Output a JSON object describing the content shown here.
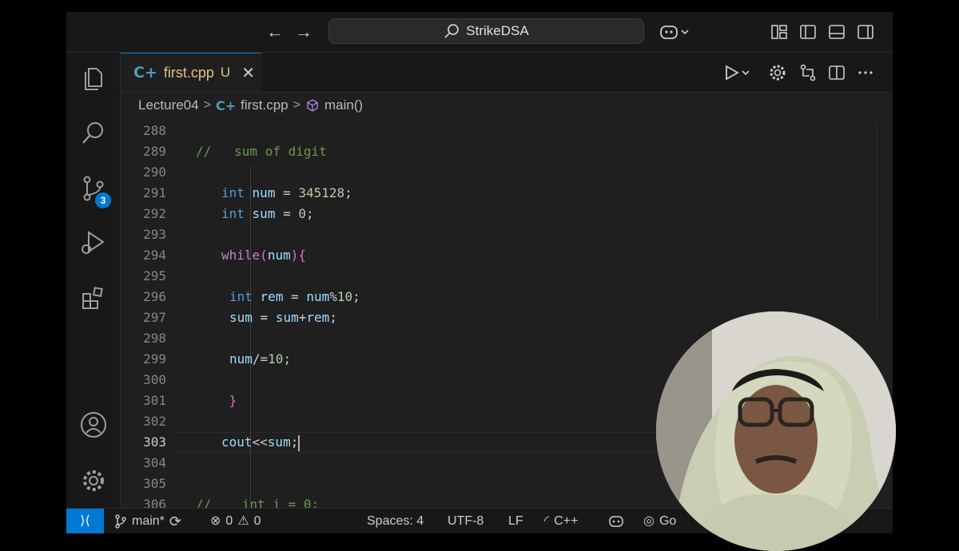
{
  "titlebar": {
    "search_label": "StrikeDSA"
  },
  "tab": {
    "filename": "first.cpp",
    "status": "U",
    "lang_glyph": "C+"
  },
  "breadcrumb": {
    "folder": "Lecture04",
    "file": "first.cpp",
    "symbol": "main()"
  },
  "editor": {
    "active_line": "303",
    "lines": [
      {
        "n": "288"
      },
      {
        "n": "289"
      },
      {
        "n": "290"
      },
      {
        "n": "291"
      },
      {
        "n": "292"
      },
      {
        "n": "293"
      },
      {
        "n": "294"
      },
      {
        "n": "295"
      },
      {
        "n": "296"
      },
      {
        "n": "297"
      },
      {
        "n": "298"
      },
      {
        "n": "299"
      },
      {
        "n": "300"
      },
      {
        "n": "301"
      },
      {
        "n": "302"
      },
      {
        "n": "303"
      },
      {
        "n": "304"
      },
      {
        "n": "305"
      },
      {
        "n": "306"
      }
    ]
  },
  "activity": {
    "source_control_badge": "3"
  },
  "statusbar": {
    "remote_icon": "remote-icon",
    "branch": "main*",
    "errors": "0",
    "warnings": "0",
    "spaces": "Spaces: 4",
    "encoding": "UTF-8",
    "eol": "LF",
    "language": "C++",
    "go_live": "Go"
  },
  "colors": {
    "accent": "#0078d4",
    "modified": "#e2c08d",
    "cpp_icon": "#519aba"
  }
}
